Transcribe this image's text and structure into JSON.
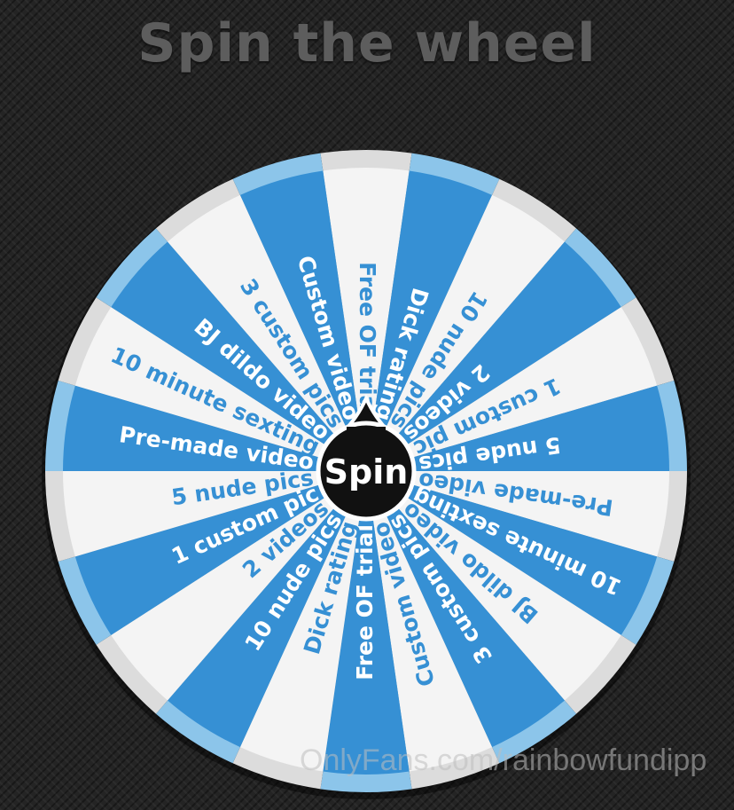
{
  "title": "Spin the wheel",
  "spin_label": "Spin",
  "watermark": "OnlyFans.com/rainbowfundipp",
  "colors": {
    "background": "#242424",
    "segment_blue": "#3690d4",
    "segment_white": "#f4f4f4",
    "rim": "#8cc5ea",
    "text_on_blue": "#ffffff",
    "text_on_white": "#3690d4",
    "hub": "#111111",
    "title": "#5d5d5d"
  },
  "segments": [
    "Free OF trial",
    "Dick rating",
    "10 nude pics",
    "2 videos",
    "1 custom pic",
    "5 nude pics",
    "Pre-made video",
    "10 minute sexting",
    "BJ dildo video",
    "3 custom pics",
    "Custom video",
    "Free OF trial",
    "Dick rating",
    "10 nude pics",
    "2 videos",
    "1 custom pic",
    "5 nude pics",
    "Pre-made video",
    "10 minute sexting",
    "BJ dildo video",
    "3 custom pics",
    "Custom video"
  ]
}
